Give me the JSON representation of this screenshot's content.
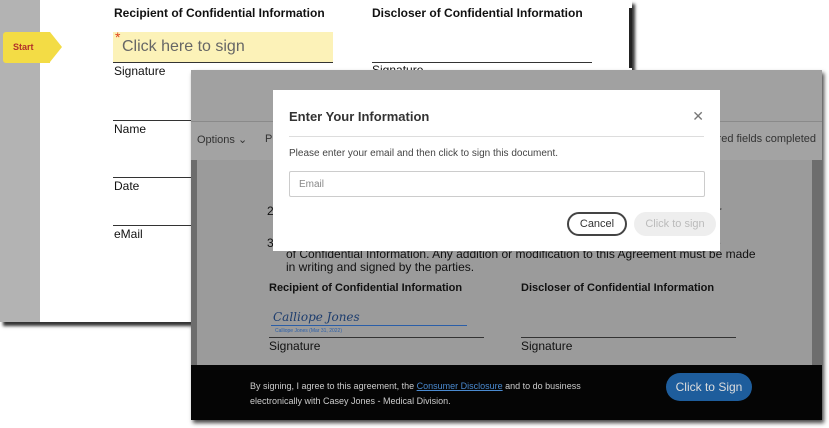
{
  "back_doc": {
    "recipient_heading": "Recipient of Confidential Information",
    "discloser_heading": "Discloser of Confidential Information",
    "start_label": "Start",
    "sign_placeholder": "Click here to sign",
    "required_mark": "*",
    "signature_label": "Signature",
    "name_label": "Name",
    "date_label": "Date",
    "email_label": "eMail",
    "discloser_signature_label": "Signature"
  },
  "front": {
    "options_label": "Options",
    "options_icon": "chevron-down-icon",
    "toolbar_partial": "P",
    "fields_status": "uired fields completed",
    "side_partials": [
      "ss",
      "ser",
      "re"
    ],
    "item_numbers": [
      "2",
      "3"
    ],
    "paragraph": "of Confidential Information. Any addition or modification to this Agreement must be made in writing and signed by the parties.",
    "recipient_heading": "Recipient of Confidential Information",
    "discloser_heading": "Discloser of Confidential Information",
    "signature_name": "Calliope Jones",
    "signature_meta": "Calliope Jones  (Mar 31, 2022)",
    "signature_label": "Signature",
    "discloser_signature_label": "Signature",
    "footer": {
      "text_before": "By signing, I agree to this agreement, the ",
      "link": "Consumer Disclosure",
      "text_after": " and to do business electronically with Casey Jones - Medical Division.",
      "button": "Click to Sign"
    }
  },
  "modal": {
    "title": "Enter Your Information",
    "instructions": "Please enter your email and then click to sign this document.",
    "email_placeholder": "Email",
    "email_value": "",
    "cancel": "Cancel",
    "sign": "Click to sign"
  },
  "colors": {
    "start_tag": "#f3dc45",
    "sign_field": "#fcf2b8",
    "primary": "#1e5d9c"
  }
}
